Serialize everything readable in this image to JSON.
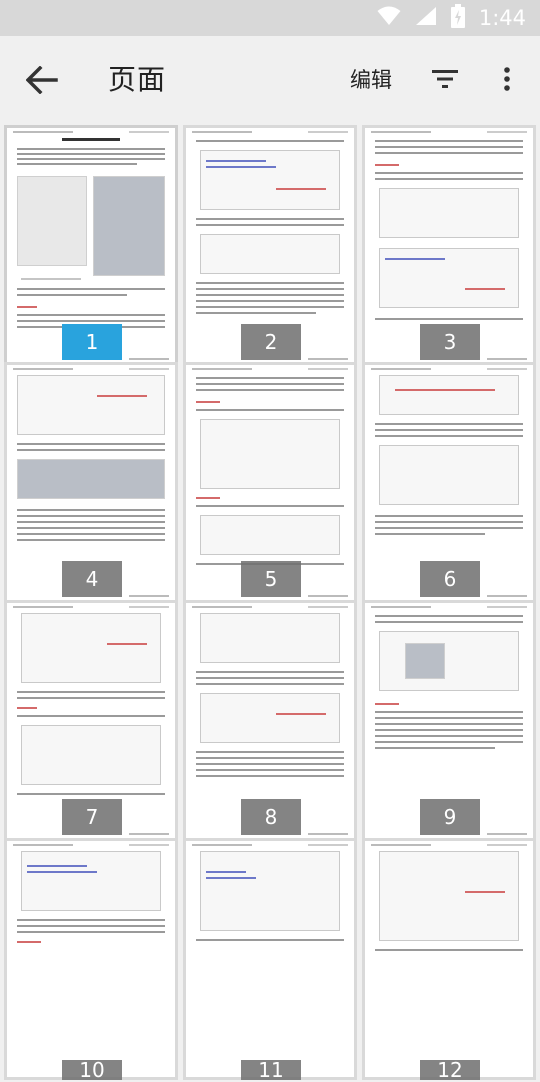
{
  "status_bar": {
    "time": "1:44"
  },
  "app_bar": {
    "title": "页面",
    "edit_label": "编辑"
  },
  "accent_color": "#29a3dd",
  "pages": [
    {
      "number": "1",
      "selected": true
    },
    {
      "number": "2",
      "selected": false
    },
    {
      "number": "3",
      "selected": false
    },
    {
      "number": "4",
      "selected": false
    },
    {
      "number": "5",
      "selected": false
    },
    {
      "number": "6",
      "selected": false
    },
    {
      "number": "7",
      "selected": false
    },
    {
      "number": "8",
      "selected": false
    },
    {
      "number": "9",
      "selected": false
    },
    {
      "number": "10",
      "selected": false
    },
    {
      "number": "11",
      "selected": false
    },
    {
      "number": "12",
      "selected": false
    }
  ]
}
